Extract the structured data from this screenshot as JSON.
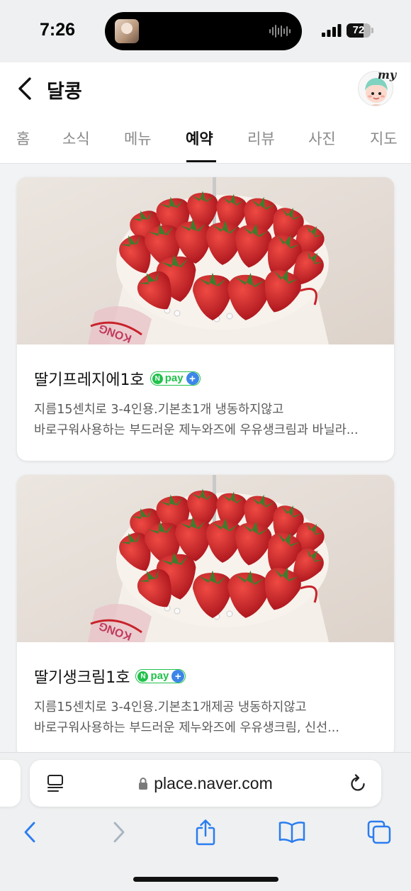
{
  "status_bar": {
    "time": "7:26",
    "battery_level": "72",
    "battery_fraction": 0.72
  },
  "header": {
    "title": "달콩",
    "my_label": "my"
  },
  "tabs": [
    {
      "label": "홈"
    },
    {
      "label": "소식"
    },
    {
      "label": "메뉴"
    },
    {
      "label": "예약",
      "active": true
    },
    {
      "label": "리뷰"
    },
    {
      "label": "사진"
    },
    {
      "label": "지도"
    }
  ],
  "products": [
    {
      "title": "딸기프레지에1호",
      "npay_label": "pay",
      "description": "지름15센치로 3-4인용.기본초1개 냉동하지않고 바로구워사용하는 부드러운 제누와즈에 우유생크림과 바닐라..."
    },
    {
      "title": "딸기생크림1호",
      "npay_label": "pay",
      "description": "지름15센치로 3-4인용.기본초1개제공 냉동하지않고 바로구워사용하는 부드러운 제누와즈에 우유생크림, 신선..."
    }
  ],
  "cake_box_text": "KONG",
  "browser": {
    "url": "place.naver.com"
  },
  "colors": {
    "npay_green": "#21c14b",
    "npay_blue": "#3c86e8",
    "ios_blue": "#2a7cf0",
    "strawberry_red": "#c8222a"
  }
}
